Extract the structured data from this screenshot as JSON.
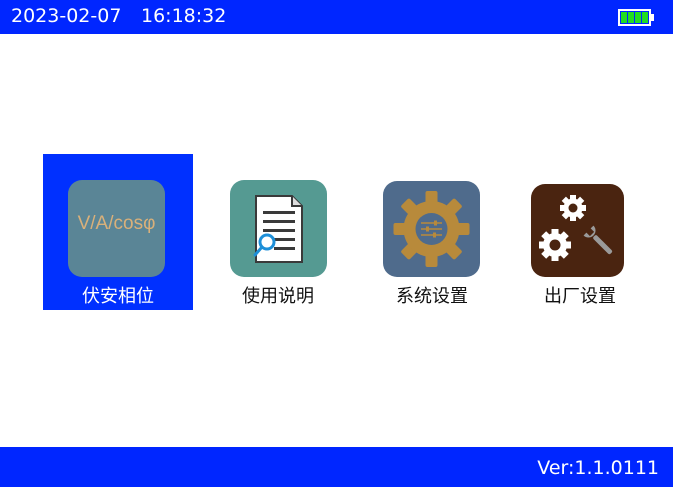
{
  "status_bar": {
    "date": "2023-02-07",
    "time": "16:18:32",
    "battery_icon": "battery-full-icon",
    "battery_level": 1.0,
    "battery_color": "#22dd22"
  },
  "menu": {
    "selected_index": 0,
    "items": [
      {
        "label": "伏安相位",
        "icon_text": "V/A/cosφ",
        "icon": "vac-phase-icon",
        "tile_color": "#5a8596"
      },
      {
        "label": "使用说明",
        "icon": "document-search-icon",
        "tile_color": "#559a92"
      },
      {
        "label": "系统设置",
        "icon": "gear-icon",
        "tile_color": "#4f6b8c"
      },
      {
        "label": "出厂设置",
        "icon": "gears-wrench-icon",
        "tile_color": "#4a2410"
      }
    ]
  },
  "footer": {
    "version": "Ver:1.1.0111"
  },
  "colors": {
    "bar_blue": "#0026ff",
    "selection_blue": "#0030ff",
    "background": "#ffffff"
  }
}
